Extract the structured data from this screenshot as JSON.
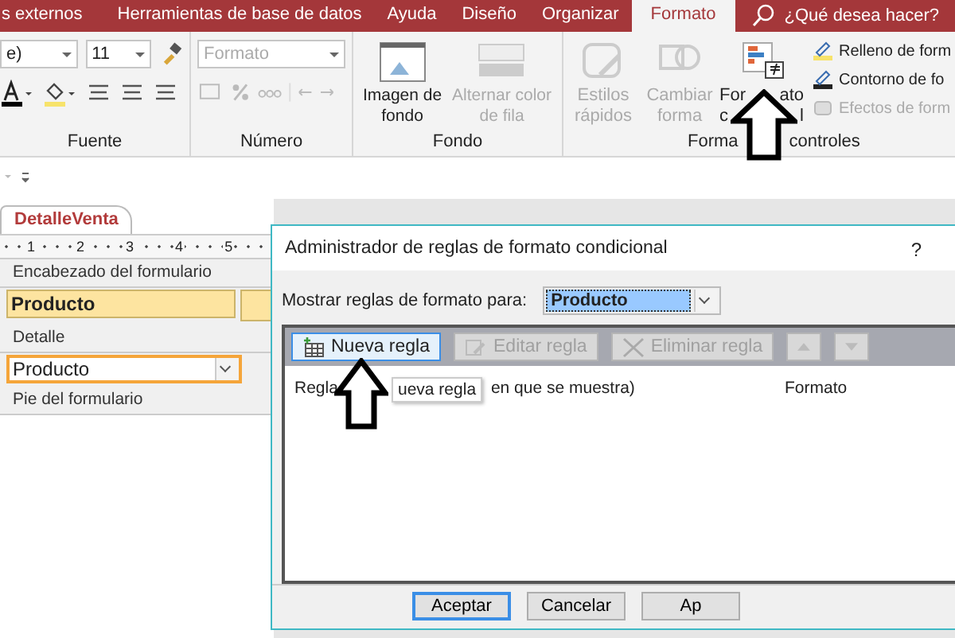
{
  "menu_tabs": [
    {
      "label": "s externos",
      "selected": false
    },
    {
      "label": "Herramientas de base de datos",
      "selected": false
    },
    {
      "label": "Ayuda",
      "selected": false
    },
    {
      "label": "Diseño",
      "selected": false
    },
    {
      "label": "Organizar",
      "selected": false
    },
    {
      "label": "Formato",
      "selected": true
    }
  ],
  "search": {
    "placeholder": "¿Qué desea hacer?"
  },
  "ribbon": {
    "font_name": "e)",
    "font_size": "11",
    "number_format": "Formato",
    "groups": {
      "font": "Fuente",
      "number": "Número",
      "background": "Fondo",
      "controls_parts": [
        "Forma",
        "controles"
      ]
    },
    "large_buttons": [
      {
        "kind": "background",
        "label": "Imagen de fondo",
        "disabled": false
      },
      {
        "kind": "alternate",
        "label": "Alternar color de fila",
        "disabled": true
      },
      {
        "kind": "styles",
        "label": "Estilos rápidos",
        "disabled": true
      },
      {
        "kind": "shape",
        "label": "Cambiar forma",
        "disabled": true
      }
    ],
    "conditional_button": {
      "label_lines": [
        [
          "For",
          "ato"
        ],
        [
          "c",
          "l"
        ]
      ]
    },
    "small_buttons": [
      {
        "kind": "fill",
        "label": "Relleno de form",
        "disabled": false
      },
      {
        "kind": "outline",
        "label": "Contorno de fo",
        "disabled": false
      },
      {
        "kind": "effects",
        "label": "Efectos de form",
        "disabled": true
      }
    ]
  },
  "document": {
    "tab": "DetalleVenta",
    "ruler": [
      "1",
      "2",
      "3",
      "4",
      "5"
    ],
    "sections": [
      {
        "title": "Encabezado del formulario",
        "control": {
          "kind": "label",
          "text": "Producto"
        }
      },
      {
        "title": "Detalle",
        "control": {
          "kind": "combo",
          "text": "Producto"
        }
      },
      {
        "title": "Pie del formulario"
      }
    ]
  },
  "dialog": {
    "title": "Administrador de reglas de formato condicional",
    "help": "?",
    "show_label": "Mostrar reglas de formato para:",
    "show_value": "Producto",
    "toolbar": [
      {
        "kind": "new",
        "label": "Nueva regla",
        "disabled": false
      },
      {
        "kind": "edit",
        "label": "Editar regla",
        "disabled": true
      },
      {
        "kind": "delete",
        "label": "Eliminar regla",
        "disabled": true
      },
      {
        "kind": "up",
        "disabled": true
      },
      {
        "kind": "down",
        "disabled": true
      }
    ],
    "rule_column_parts": [
      "Regla",
      "en que se muestra)"
    ],
    "format_column": "Formato",
    "tooltip": "ueva regla",
    "buttons": [
      "Aceptar",
      "Cancelar",
      "Ap"
    ]
  }
}
